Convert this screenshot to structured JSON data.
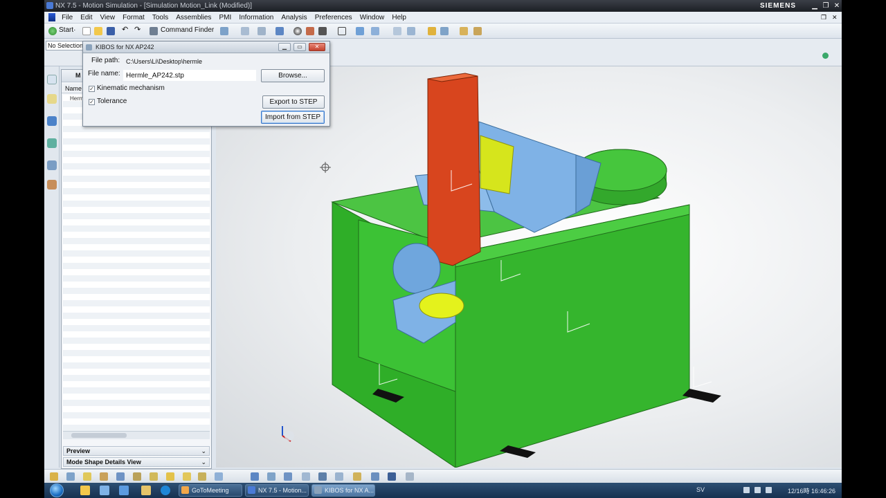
{
  "window": {
    "title": "NX 7.5 - Motion Simulation - [Simulation Motion_Link (Modified)]",
    "brand": "SIEMENS",
    "controls": [
      "minimize",
      "restore",
      "close"
    ]
  },
  "menu": [
    "File",
    "Edit",
    "View",
    "Format",
    "Tools",
    "Assemblies",
    "PMI",
    "Information",
    "Analysis",
    "Preferences",
    "Window",
    "Help"
  ],
  "toolbar": {
    "start_label": "Start·",
    "command_finder_label": "Command Finder"
  },
  "selection_bar": {
    "filter_label": "No Selection Filter"
  },
  "navigator": {
    "header_label": "M",
    "column_name": "Name",
    "tree_nodes": [
      "Herm"
    ],
    "preview_label": "Preview",
    "mode_shape_label": "Mode Shape Details View"
  },
  "dialog": {
    "title": "KIBOS for NX AP242",
    "file_path_label": "File path:",
    "file_path_value": "C:\\Users\\Li\\Desktop\\hermle",
    "file_name_label": "File name:",
    "file_name_value": "Hermle_AP242.stp",
    "browse_label": "Browse...",
    "kinematic_label": "Kinematic mechanism",
    "kinematic_checked": true,
    "tolerance_label": "Tolerance",
    "tolerance_checked": true,
    "export_label": "Export to STEP",
    "import_label": "Import from STEP"
  },
  "taskbar": {
    "buttons": [
      {
        "label": "GoToMeeting",
        "active": false
      },
      {
        "label": "NX 7.5 - Motion...",
        "active": false
      },
      {
        "label": "KIBOS for NX A...",
        "active": true
      }
    ],
    "language": "SV",
    "clock": "12/16時 16:46:26"
  },
  "colors": {
    "base": "#31b32a",
    "column": "#d8451e",
    "blue_parts": "#7fb2e6",
    "yellow_parts": "#d6e51c"
  }
}
